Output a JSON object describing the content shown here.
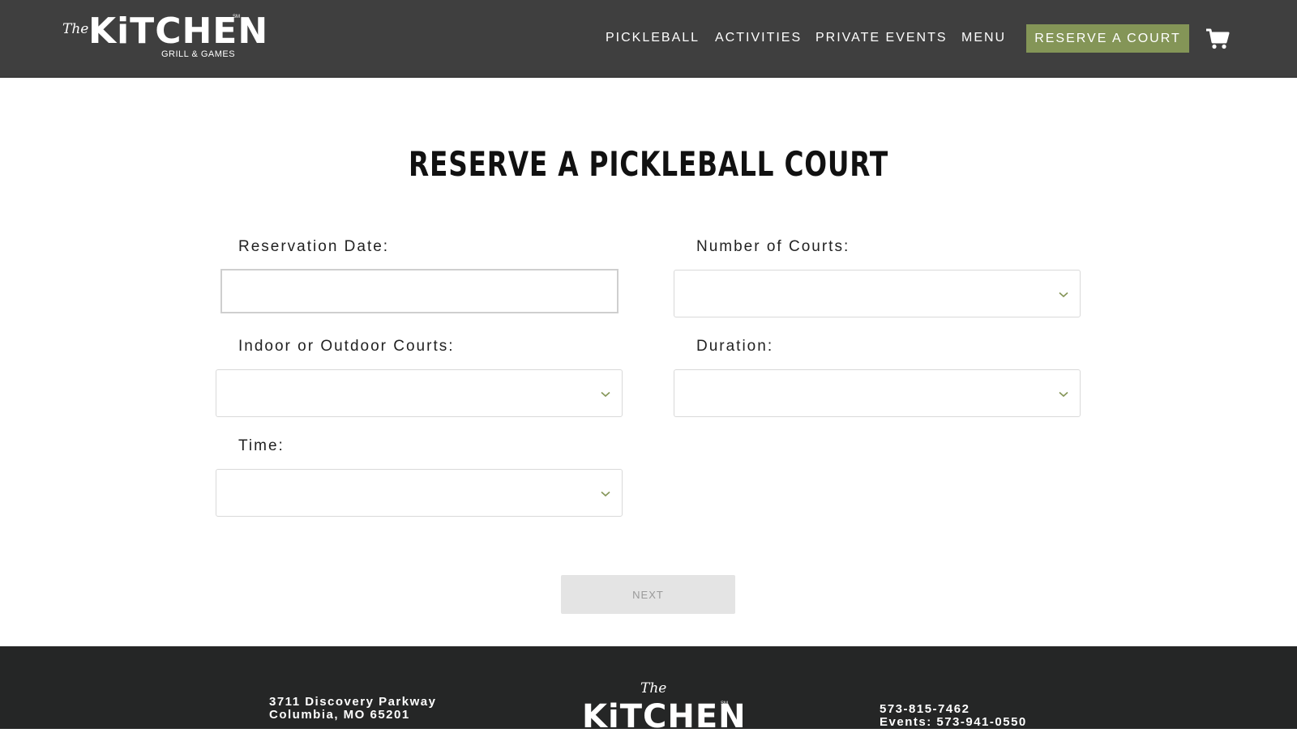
{
  "header": {
    "logo": {
      "the": "The",
      "name": "KiTCHEN",
      "sub": "GRILL & GAMES",
      "mark": "SM"
    },
    "nav": [
      "PICKLEBALL",
      "ACTIVITIES",
      "PRIVATE EVENTS",
      "MENU"
    ],
    "reserve_label": "RESERVE A COURT",
    "cart_icon": "cart-icon"
  },
  "main": {
    "title": "RESERVE A PICKLEBALL COURT",
    "fields": {
      "date_label": "Reservation Date:",
      "courts_label": "Number of Courts:",
      "indoor_label": "Indoor or Outdoor Courts:",
      "duration_label": "Duration:",
      "time_label": "Time:"
    },
    "next_label": "NEXT"
  },
  "footer": {
    "address_line1": "3711 Discovery Parkway",
    "address_line2": "Columbia, MO 65201",
    "logo_the": "The",
    "logo_name": "KiTCHEN",
    "logo_mark": "SM",
    "phone": "573-815-7462",
    "events_phone": "Events: 573-941-0550"
  },
  "colors": {
    "header_bg": "#3f3f3f",
    "accent": "#849557",
    "footer_bg": "#252626"
  }
}
